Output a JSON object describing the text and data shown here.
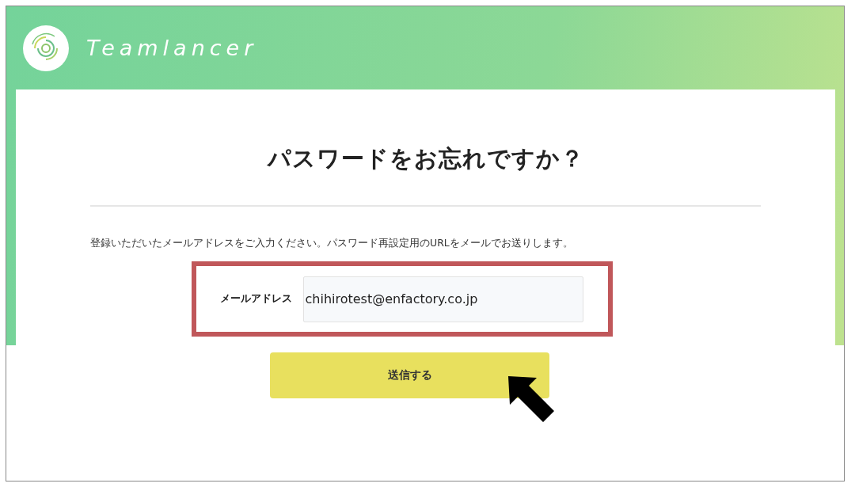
{
  "header": {
    "brand": "Teamlancer"
  },
  "card": {
    "title": "パスワードをお忘れですか？",
    "description": "登録いただいたメールアドレスをご入力ください。パスワード再設定用のURLをメールでお送りします。",
    "field": {
      "label": "メールアドレス",
      "value": "chihirotest@enfactory.co.jp"
    },
    "submit_button": "送信する"
  }
}
